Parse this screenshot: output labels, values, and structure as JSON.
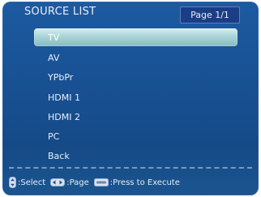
{
  "header": {
    "title": "SOURCE LIST",
    "page_indicator": "Page 1/1"
  },
  "source_list": {
    "items": [
      {
        "label": "TV",
        "selected": true
      },
      {
        "label": "AV",
        "selected": false
      },
      {
        "label": "YPbPr",
        "selected": false
      },
      {
        "label": "HDMI 1",
        "selected": false
      },
      {
        "label": "HDMI 2",
        "selected": false
      },
      {
        "label": "PC",
        "selected": false
      },
      {
        "label": "Back",
        "selected": false
      }
    ]
  },
  "footer": {
    "select_label": ":Select",
    "page_label": ":Page",
    "execute_label": ":Press to Execute",
    "icons": [
      "up-down-icon",
      "left-right-icon",
      "enter-key-icon"
    ]
  },
  "colors": {
    "panel_blue": "#185092",
    "selection_teal": "#a9d4d8",
    "badge_blue": "#1b3d86"
  }
}
